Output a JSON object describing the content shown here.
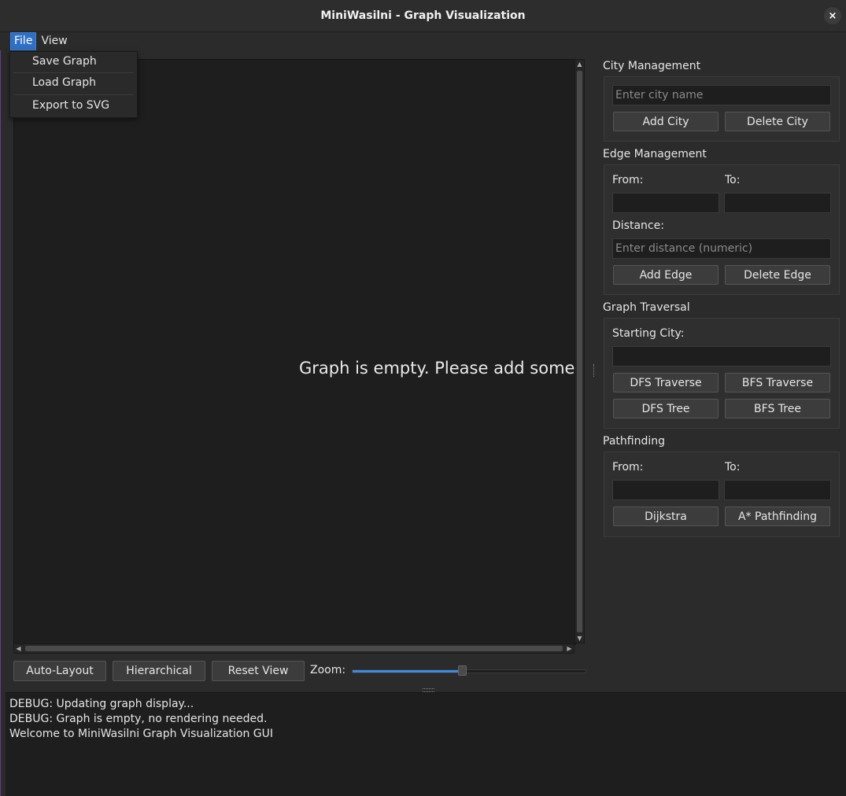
{
  "window": {
    "title": "MiniWasilni - Graph Visualization",
    "close_icon": "×"
  },
  "menu": {
    "file": "File",
    "view": "View",
    "file_items": [
      "Save Graph",
      "Load Graph",
      "Export to SVG"
    ]
  },
  "canvas": {
    "empty_message": "Graph is empty. Please add some"
  },
  "toolbar": {
    "auto_layout": "Auto-Layout",
    "hierarchical": "Hierarchical",
    "reset_view": "Reset View",
    "zoom_label": "Zoom:",
    "zoom_value_fraction": 0.47
  },
  "city_management": {
    "title": "City Management",
    "city_placeholder": "Enter city name",
    "add_city": "Add City",
    "delete_city": "Delete City"
  },
  "edge_management": {
    "title": "Edge Management",
    "from_label": "From:",
    "to_label": "To:",
    "distance_label": "Distance:",
    "distance_placeholder": "Enter distance (numeric)",
    "add_edge": "Add Edge",
    "delete_edge": "Delete Edge"
  },
  "graph_traversal": {
    "title": "Graph Traversal",
    "starting_city_label": "Starting City:",
    "dfs_traverse": "DFS Traverse",
    "bfs_traverse": "BFS Traverse",
    "dfs_tree": "DFS Tree",
    "bfs_tree": "BFS Tree"
  },
  "pathfinding": {
    "title": "Pathfinding",
    "from_label": "From:",
    "to_label": "To:",
    "dijkstra": "Dijkstra",
    "astar": "A* Pathfinding"
  },
  "log": {
    "lines": [
      "DEBUG: Updating graph display...",
      "DEBUG: Graph is empty, no rendering needed.",
      "Welcome to MiniWasilni Graph Visualization GUI"
    ]
  }
}
